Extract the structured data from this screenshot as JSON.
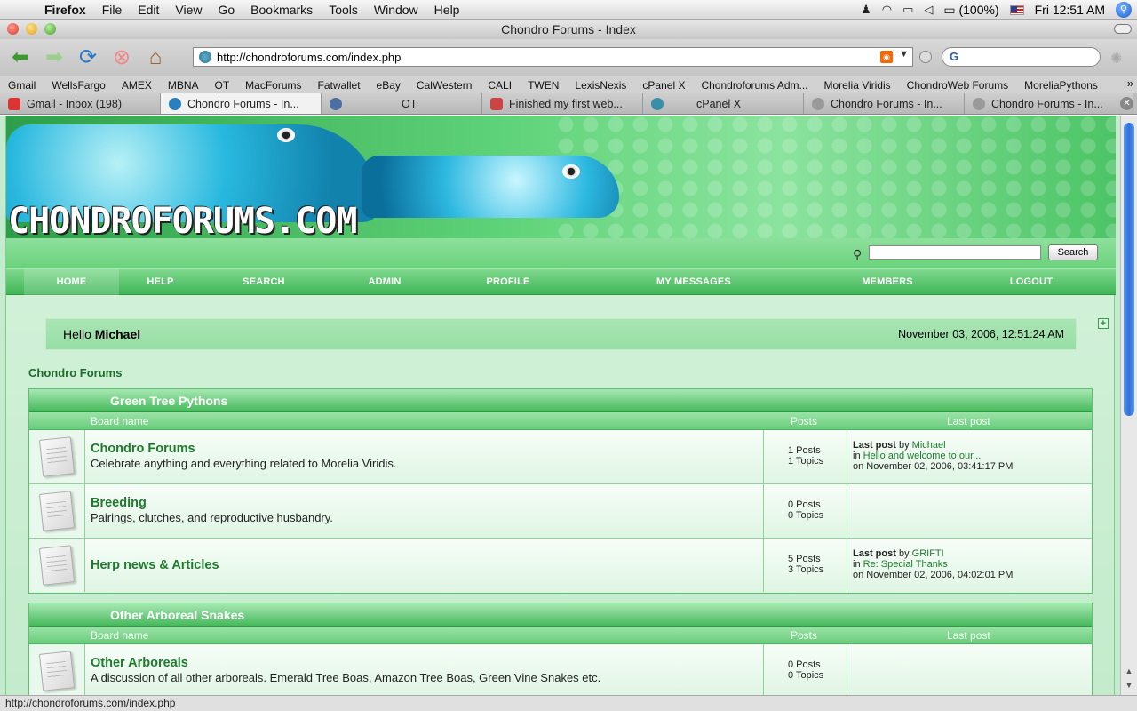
{
  "os_menubar": {
    "app": "Firefox",
    "menus": [
      "File",
      "Edit",
      "View",
      "Go",
      "Bookmarks",
      "Tools",
      "Window",
      "Help"
    ],
    "battery": "(100%)",
    "clock": "Fri 12:51 AM"
  },
  "window": {
    "title": "Chondro Forums - Index"
  },
  "toolbar": {
    "url": "http://chondroforums.com/index.php",
    "search_engine_letter": "G"
  },
  "bookmarks": [
    "Gmail",
    "WellsFargo",
    "AMEX",
    "MBNA",
    "OT",
    "MacForums",
    "Fatwallet",
    "eBay",
    "CalWestern",
    "CALI",
    "TWEN",
    "LexisNexis",
    "cPanel X",
    "Chondroforums Adm...",
    "Morelia Viridis",
    "ChondroWeb Forums",
    "MoreliaPythons"
  ],
  "tabs": [
    {
      "label": "Gmail - Inbox (198)",
      "color": "#d33"
    },
    {
      "label": "Chondro Forums - In...",
      "color": "#2a7fbf"
    },
    {
      "label": "OT",
      "color": "#4a6fa0"
    },
    {
      "label": "Finished my first web...",
      "color": "#c44"
    },
    {
      "label": "cPanel X",
      "color": "#3a8fa8"
    },
    {
      "label": "Chondro Forums - In...",
      "color": "#999"
    },
    {
      "label": "Chondro Forums - In...",
      "color": "#999"
    }
  ],
  "site": {
    "logo": "CHONDROFORUMS.COM",
    "search_button": "Search",
    "nav": [
      "HOME",
      "HELP",
      "SEARCH",
      "ADMIN",
      "PROFILE",
      "MY MESSAGES",
      "MEMBERS",
      "LOGOUT"
    ],
    "greeting": "Hello",
    "username": "Michael",
    "datetime": "November 03, 2006, 12:51:24 AM",
    "breadcrumb": "Chondro Forums"
  },
  "columns": {
    "board": "Board name",
    "posts": "Posts",
    "last": "Last post"
  },
  "categories": [
    {
      "title": "Green Tree Pythons",
      "boards": [
        {
          "name": "Chondro Forums",
          "desc": "Celebrate anything and everything related to Morelia Viridis.",
          "posts": "1 Posts",
          "topics": "1 Topics",
          "last_label": "Last post",
          "by": "by",
          "user": "Michael",
          "in": "in",
          "topic": "Hello and welcome to our...",
          "on": "on November 02, 2006, 03:41:17 PM"
        },
        {
          "name": "Breeding",
          "desc": "Pairings, clutches, and reproductive husbandry.",
          "posts": "0 Posts",
          "topics": "0 Topics"
        },
        {
          "name": "Herp news & Articles",
          "desc": "",
          "posts": "5 Posts",
          "topics": "3 Topics",
          "last_label": "Last post",
          "by": "by",
          "user": "GRIFTI",
          "in": "in",
          "topic": "Re: Special Thanks",
          "on": "on November 02, 2006, 04:02:01 PM"
        }
      ]
    },
    {
      "title": "Other Arboreal Snakes",
      "boards": [
        {
          "name": "Other Arboreals",
          "desc": "A discussion of all other arboreals. Emerald Tree Boas, Amazon Tree Boas, Green Vine Snakes etc.",
          "posts": "0 Posts",
          "topics": "0 Topics"
        }
      ]
    }
  ],
  "status": "http://chondroforums.com/index.php"
}
